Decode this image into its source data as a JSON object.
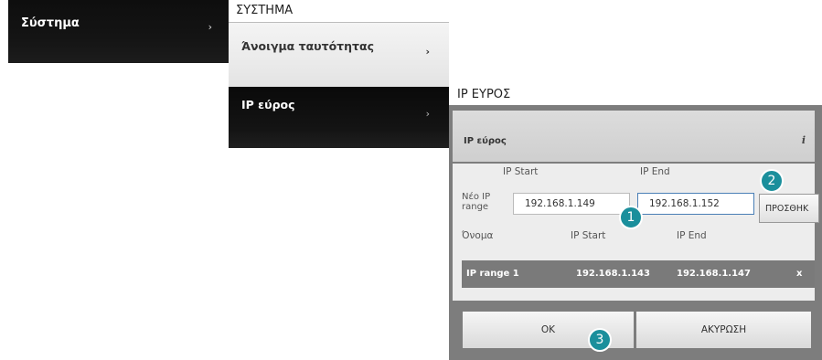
{
  "menu": {
    "system_label": "Σύστημα",
    "section_title": "ΣΥΣΤΗΜΑ",
    "items": [
      {
        "label": "Άνοιγμα ταυτότητας"
      },
      {
        "label": "IP εύρος"
      }
    ],
    "chevron": "›"
  },
  "dialog": {
    "title": "IP ΕΥΡΟΣ",
    "header_label": "IP εύρος",
    "info_icon": "i",
    "form": {
      "new_range_label": "Νέο IP range",
      "ip_start_label": "IP Start",
      "ip_end_label": "IP End",
      "ip_start_value": "192.168.1.149",
      "ip_end_value": "192.168.1.152",
      "add_button": "ΠΡΟΣΘΗΚ"
    },
    "table": {
      "columns": [
        "Όνομα",
        "IP Start",
        "IP End"
      ],
      "rows": [
        {
          "name": "IP range 1",
          "start": "192.168.1.143",
          "end": "192.168.1.147",
          "remove": "x"
        }
      ]
    },
    "ok_button": "OK",
    "cancel_button": "ΑΚΥΡΩΣΗ"
  },
  "callouts": [
    "1",
    "2",
    "3"
  ],
  "colors": {
    "callout": "#1a8f9c",
    "field_active_border": "#4a7fb6"
  }
}
